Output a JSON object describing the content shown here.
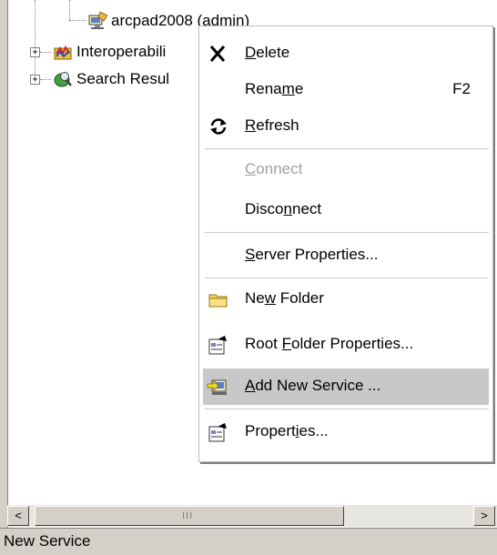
{
  "tree": {
    "items": [
      {
        "label": "arcpad2008 (admin)",
        "icon": "server-icon"
      },
      {
        "label": "Interoperabili",
        "icon": "interoperability-icon"
      },
      {
        "label": "Search Resul",
        "icon": "search-results-icon"
      }
    ]
  },
  "context_menu": {
    "items": [
      {
        "pre": "",
        "u": "D",
        "post": "elete",
        "icon": "delete-x-icon"
      },
      {
        "pre": "Rena",
        "u": "m",
        "post": "e",
        "shortcut": "F2"
      },
      {
        "pre": "",
        "u": "R",
        "post": "efresh",
        "icon": "refresh-icon"
      },
      {
        "pre": "",
        "u": "C",
        "post": "onnect",
        "disabled": true
      },
      {
        "pre": "Disco",
        "u": "n",
        "post": "nect"
      },
      {
        "pre": "",
        "u": "S",
        "post": "erver Properties..."
      },
      {
        "pre": "Ne",
        "u": "w",
        "post": " Folder",
        "icon": "folder-icon"
      },
      {
        "pre": "Root ",
        "u": "F",
        "post": "older Properties...",
        "icon": "properties-icon"
      },
      {
        "pre": "",
        "u": "A",
        "post": "dd New Service ...",
        "icon": "add-service-icon",
        "selected": true
      },
      {
        "pre": "Propert",
        "u": "i",
        "post": "es...",
        "icon": "properties-icon"
      }
    ]
  },
  "scrollbar": {
    "left_arrow": "<",
    "right_arrow": ">",
    "grip": "III"
  },
  "status_bar": {
    "text": "New Service"
  },
  "colors": {
    "menu_selected": "#c8c8c8",
    "disabled_text": "#a0a0a0",
    "chrome": "#d4d0c8"
  }
}
